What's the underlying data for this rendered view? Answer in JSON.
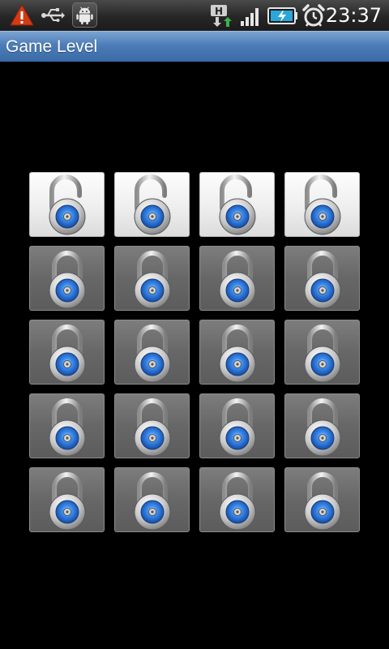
{
  "status_bar": {
    "time": "23:37",
    "icons": [
      "warning-icon",
      "usb-icon",
      "android-debug-icon",
      "hsdpa-icon",
      "signal-icon",
      "battery-charging-icon",
      "alarm-icon"
    ]
  },
  "title_bar": {
    "title": "Game Level"
  },
  "levels": [
    {
      "state": "unlocked"
    },
    {
      "state": "unlocked"
    },
    {
      "state": "unlocked"
    },
    {
      "state": "unlocked"
    },
    {
      "state": "locked"
    },
    {
      "state": "locked"
    },
    {
      "state": "locked"
    },
    {
      "state": "locked"
    },
    {
      "state": "locked"
    },
    {
      "state": "locked"
    },
    {
      "state": "locked"
    },
    {
      "state": "locked"
    },
    {
      "state": "locked"
    },
    {
      "state": "locked"
    },
    {
      "state": "locked"
    },
    {
      "state": "locked"
    },
    {
      "state": "locked"
    },
    {
      "state": "locked"
    },
    {
      "state": "locked"
    },
    {
      "state": "locked"
    }
  ],
  "colors": {
    "title_bar": "#4d7db8",
    "lock_dial": "#2f7de0",
    "background": "#000000"
  }
}
